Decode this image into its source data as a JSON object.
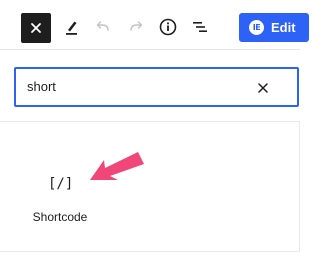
{
  "toolbar": {
    "close_icon": "close-icon",
    "tools_icon": "pencil-icon",
    "undo_icon": "undo-icon",
    "redo_icon": "redo-icon",
    "details_icon": "info-icon",
    "outline_icon": "list-view-icon",
    "edit_button_label": "Edit",
    "accent_color": "#2c62f6"
  },
  "search": {
    "value": "short",
    "clear_icon": "close-icon"
  },
  "results": {
    "items": [
      {
        "icon": "[/]",
        "label": "Shortcode"
      }
    ]
  },
  "annotation": {
    "arrow_color": "#f0467a"
  }
}
